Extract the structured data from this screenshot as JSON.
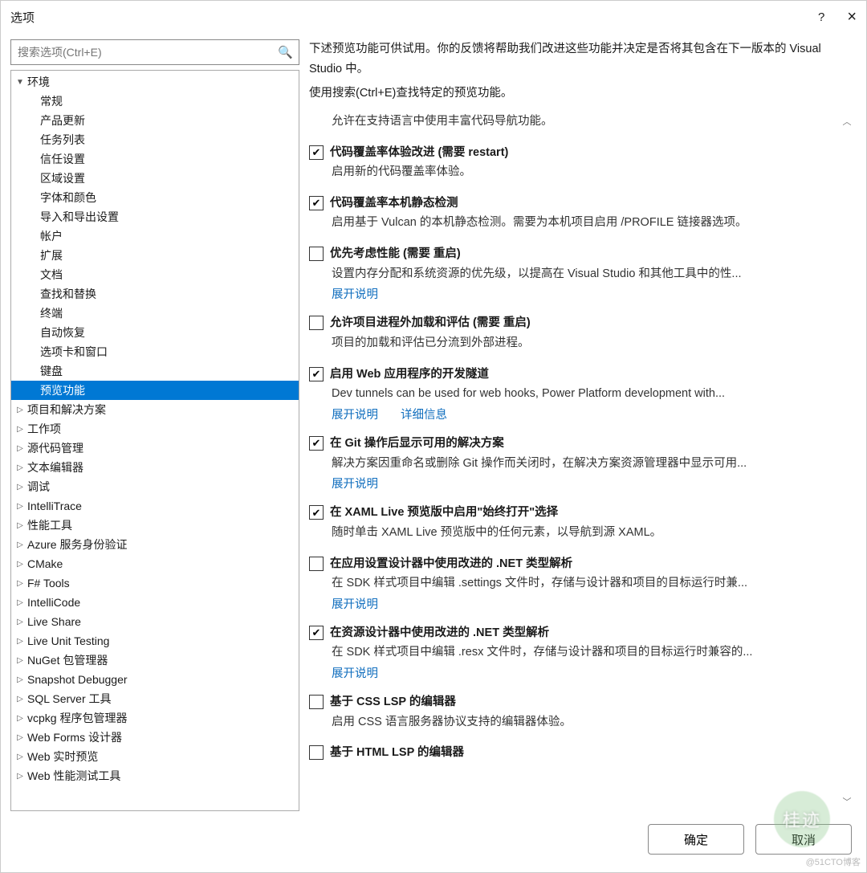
{
  "window": {
    "title": "选项",
    "help": "?",
    "close": "×"
  },
  "search": {
    "placeholder": "搜索选项(Ctrl+E)"
  },
  "tree": [
    {
      "label": "环境",
      "depth": 0,
      "exp": "▼"
    },
    {
      "label": "常规",
      "depth": 1,
      "exp": ""
    },
    {
      "label": "产品更新",
      "depth": 1,
      "exp": ""
    },
    {
      "label": "任务列表",
      "depth": 1,
      "exp": ""
    },
    {
      "label": "信任设置",
      "depth": 1,
      "exp": ""
    },
    {
      "label": "区域设置",
      "depth": 1,
      "exp": ""
    },
    {
      "label": "字体和颜色",
      "depth": 1,
      "exp": ""
    },
    {
      "label": "导入和导出设置",
      "depth": 1,
      "exp": ""
    },
    {
      "label": "帐户",
      "depth": 1,
      "exp": ""
    },
    {
      "label": "扩展",
      "depth": 1,
      "exp": ""
    },
    {
      "label": "文档",
      "depth": 1,
      "exp": ""
    },
    {
      "label": "查找和替换",
      "depth": 1,
      "exp": ""
    },
    {
      "label": "终端",
      "depth": 1,
      "exp": ""
    },
    {
      "label": "自动恢复",
      "depth": 1,
      "exp": ""
    },
    {
      "label": "选项卡和窗口",
      "depth": 1,
      "exp": ""
    },
    {
      "label": "键盘",
      "depth": 1,
      "exp": ""
    },
    {
      "label": "预览功能",
      "depth": 1,
      "exp": "",
      "selected": true
    },
    {
      "label": "项目和解决方案",
      "depth": 0,
      "exp": "▷"
    },
    {
      "label": "工作项",
      "depth": 0,
      "exp": "▷"
    },
    {
      "label": "源代码管理",
      "depth": 0,
      "exp": "▷"
    },
    {
      "label": "文本编辑器",
      "depth": 0,
      "exp": "▷"
    },
    {
      "label": "调试",
      "depth": 0,
      "exp": "▷"
    },
    {
      "label": "IntelliTrace",
      "depth": 0,
      "exp": "▷"
    },
    {
      "label": "性能工具",
      "depth": 0,
      "exp": "▷"
    },
    {
      "label": "Azure 服务身份验证",
      "depth": 0,
      "exp": "▷"
    },
    {
      "label": "CMake",
      "depth": 0,
      "exp": "▷"
    },
    {
      "label": "F# Tools",
      "depth": 0,
      "exp": "▷"
    },
    {
      "label": "IntelliCode",
      "depth": 0,
      "exp": "▷"
    },
    {
      "label": "Live Share",
      "depth": 0,
      "exp": "▷"
    },
    {
      "label": "Live Unit Testing",
      "depth": 0,
      "exp": "▷"
    },
    {
      "label": "NuGet 包管理器",
      "depth": 0,
      "exp": "▷"
    },
    {
      "label": "Snapshot Debugger",
      "depth": 0,
      "exp": "▷"
    },
    {
      "label": "SQL Server 工具",
      "depth": 0,
      "exp": "▷"
    },
    {
      "label": "vcpkg 程序包管理器",
      "depth": 0,
      "exp": "▷"
    },
    {
      "label": "Web Forms 设计器",
      "depth": 0,
      "exp": "▷"
    },
    {
      "label": "Web 实时预览",
      "depth": 0,
      "exp": "▷"
    },
    {
      "label": "Web 性能测试工具",
      "depth": 0,
      "exp": "▷"
    }
  ],
  "intro": {
    "p1": "下述预览功能可供试用。你的反馈将帮助我们改进这些功能并决定是否将其包含在下一版本的 Visual Studio 中。",
    "p2": "使用搜索(Ctrl+E)查找特定的预览功能。"
  },
  "features": [
    {
      "partial": true,
      "desc": "允许在支持语言中使用丰富代码导航功能。"
    },
    {
      "checked": true,
      "title": "代码覆盖率体验改进 (需要 restart)",
      "desc": "启用新的代码覆盖率体验。"
    },
    {
      "checked": true,
      "title": "代码覆盖率本机静态检测",
      "desc": "启用基于 Vulcan 的本机静态检测。需要为本机项目启用 /PROFILE 链接器选项。"
    },
    {
      "checked": false,
      "title": "优先考虑性能 (需要 重启)",
      "desc": "设置内存分配和系统资源的优先级，以提高在 Visual Studio 和其他工具中的性...",
      "links": [
        "展开说明"
      ]
    },
    {
      "checked": false,
      "title": "允许项目进程外加载和评估 (需要 重启)",
      "desc": "项目的加载和评估已分流到外部进程。"
    },
    {
      "checked": true,
      "title": "启用 Web 应用程序的开发隧道",
      "desc": "Dev tunnels can be used for web hooks, Power Platform development with...",
      "links": [
        "展开说明",
        "详细信息"
      ]
    },
    {
      "checked": true,
      "title": "在 Git 操作后显示可用的解决方案",
      "desc": "解决方案因重命名或删除 Git 操作而关闭时，在解决方案资源管理器中显示可用...",
      "links": [
        "展开说明"
      ]
    },
    {
      "checked": true,
      "title": "在 XAML Live 预览版中启用\"始终打开\"选择",
      "desc": "随时单击 XAML Live 预览版中的任何元素，以导航到源 XAML。"
    },
    {
      "checked": false,
      "title": "在应用设置设计器中使用改进的 .NET 类型解析",
      "desc": "在 SDK 样式项目中编辑 .settings 文件时，存储与设计器和项目的目标运行时兼...",
      "links": [
        "展开说明"
      ]
    },
    {
      "checked": true,
      "title": "在资源设计器中使用改进的 .NET 类型解析",
      "desc": "在 SDK 样式项目中编辑 .resx 文件时，存储与设计器和项目的目标运行时兼容的...",
      "links": [
        "展开说明"
      ]
    },
    {
      "checked": false,
      "title": "基于 CSS LSP 的编辑器",
      "desc": "启用 CSS 语言服务器协议支持的编辑器体验。"
    },
    {
      "checked": false,
      "title": "基于 HTML LSP 的编辑器",
      "desc": ""
    }
  ],
  "buttons": {
    "ok": "确定",
    "cancel": "取消"
  },
  "watermark": "@51CTO博客",
  "wm_circle": "桂迹"
}
